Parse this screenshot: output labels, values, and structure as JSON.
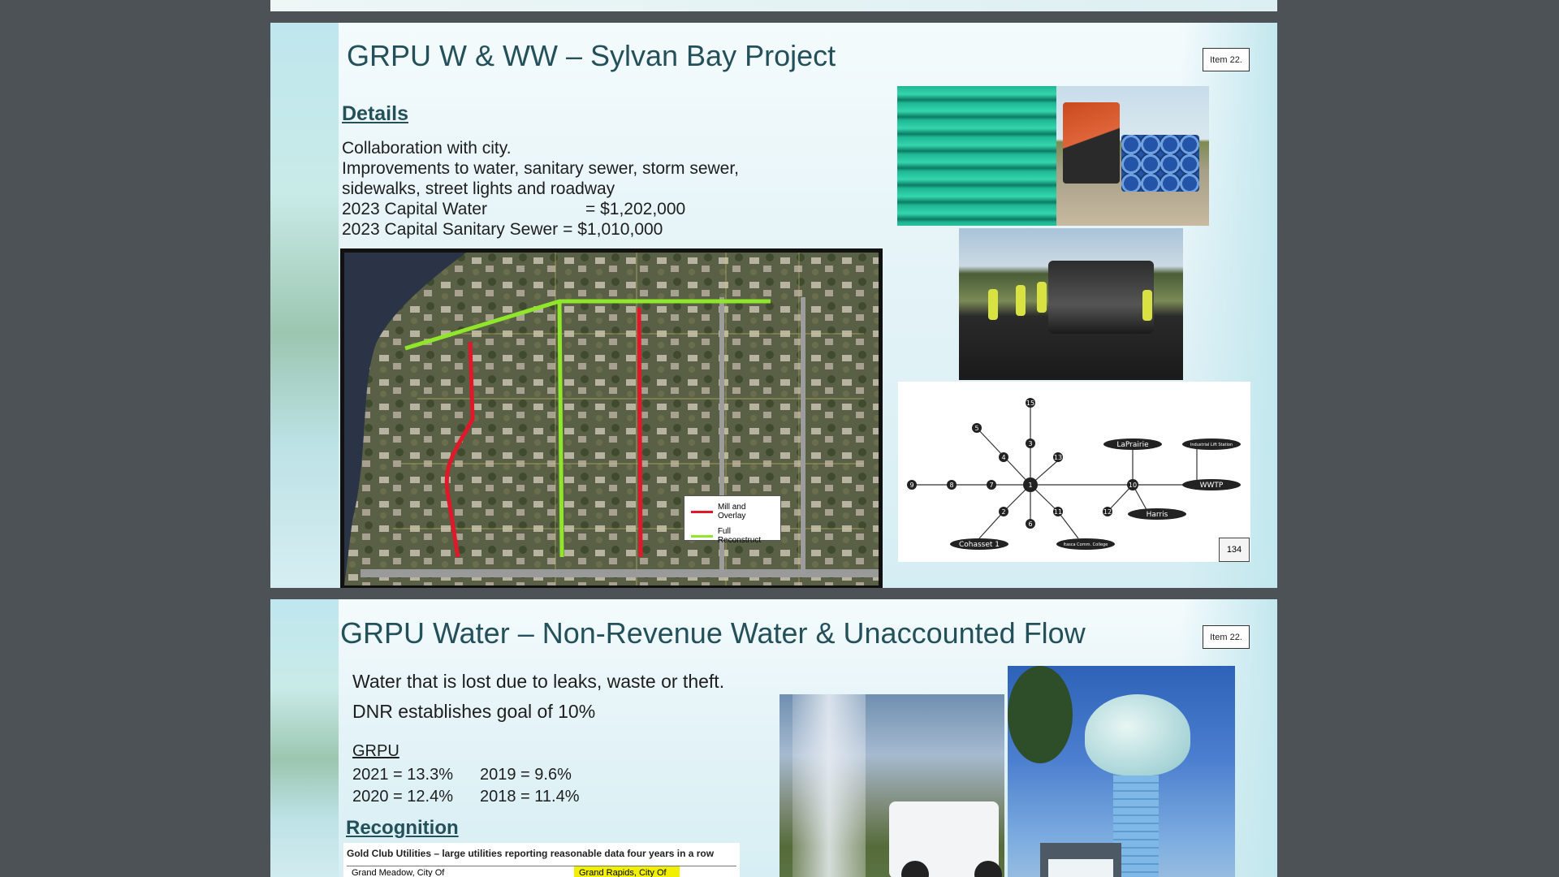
{
  "slide_a": {
    "title": "GRPU W & WW – Sylvan Bay Project",
    "item_tag": "Item 22.",
    "details_heading": "Details",
    "lines": [
      "Collaboration with city.",
      "Improvements to water, sanitary sewer, storm sewer,",
      "sidewalks, street lights and roadway"
    ],
    "capital": [
      {
        "label": "2023 Capital Water",
        "value": "= $1,202,000"
      },
      {
        "label": "2023 Capital Sanitary Sewer",
        "value": "= $1,010,000"
      }
    ],
    "legend": [
      {
        "label": "Mill and Overlay",
        "color": "#e0182a"
      },
      {
        "label": "Full Reconstruct",
        "color": "#8fe62a"
      }
    ],
    "network": {
      "numbered_nodes": [
        "1",
        "2",
        "3",
        "4",
        "5",
        "6",
        "7",
        "8",
        "9",
        "10",
        "11",
        "12",
        "13",
        "15"
      ],
      "named_nodes": [
        "LaPrairie",
        "Industrial Lift Station",
        "WWTP",
        "Harris",
        "Cohasset 1",
        "Itasca Comm. College"
      ]
    },
    "page_number": "134"
  },
  "slide_b": {
    "title": "GRPU Water – Non-Revenue Water & Unaccounted Flow",
    "item_tag": "Item 22.",
    "lines": [
      "Water that is lost due to leaks, waste or theft.",
      "DNR establishes goal of 10%"
    ],
    "grpu_heading": "GRPU",
    "stats": [
      {
        "left": "2021 = 13.3%",
        "right": "2019 = 9.6%"
      },
      {
        "left": "2020 = 12.4%",
        "right": "2018 = 11.4%"
      }
    ],
    "recognition_heading": "Recognition",
    "gold_club": {
      "title": "Gold Club Utilities – large utilities reporting reasonable data four years in a row",
      "left_cell": "Grand Meadow, City Of",
      "right_cell": "Grand Rapids, City Of"
    }
  },
  "colors": {
    "title": "#24505a",
    "background": "#4d5257",
    "highlight": "#f0f000"
  }
}
